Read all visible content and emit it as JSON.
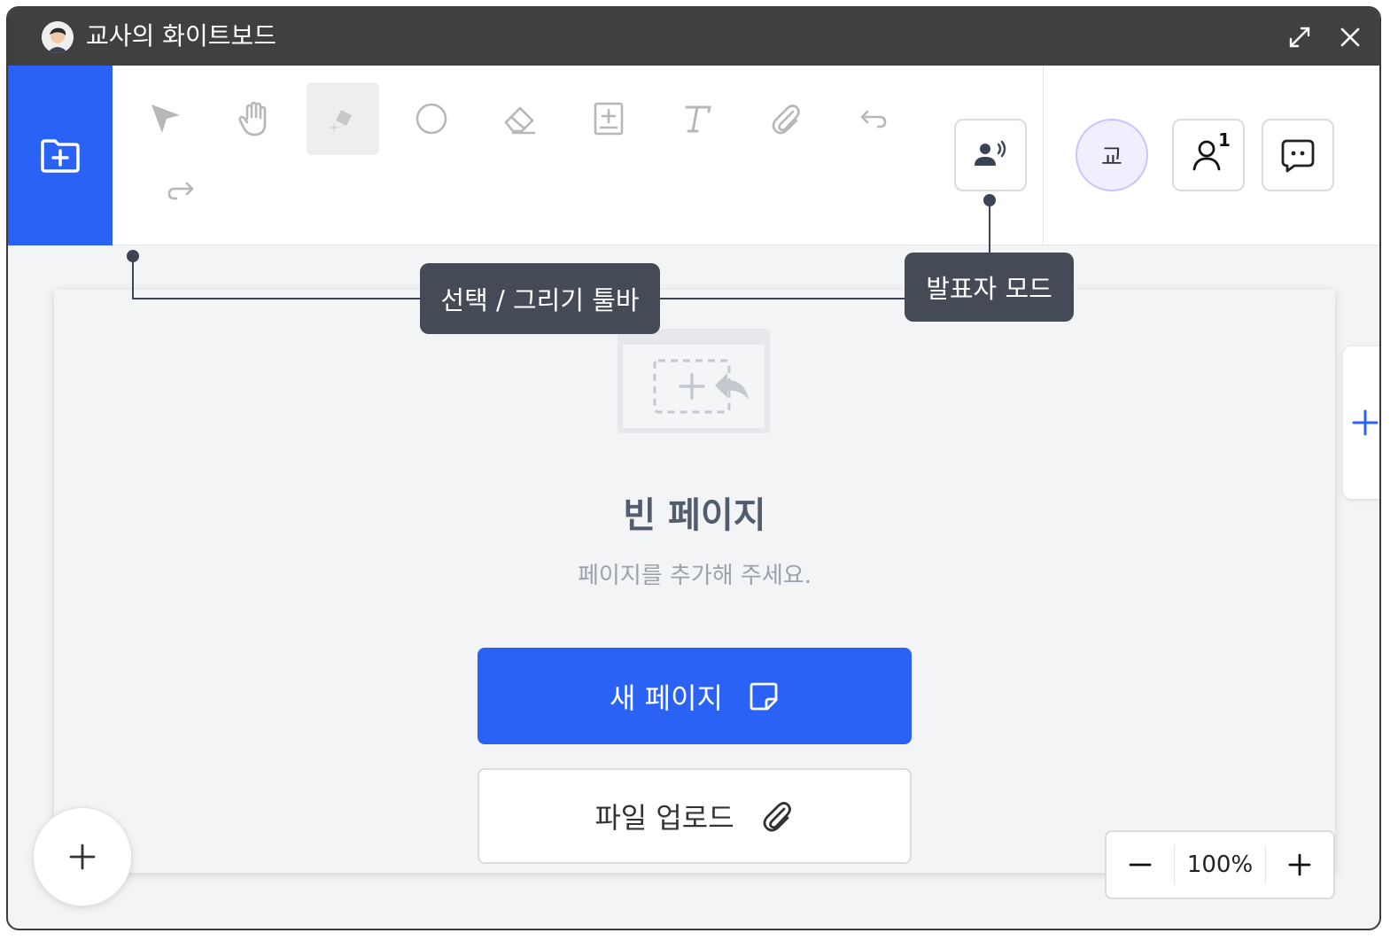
{
  "window": {
    "title": "교사의 화이트보드"
  },
  "toolbar": {
    "tools": [
      {
        "name": "select",
        "icon": "cursor-arrow-icon",
        "active": false
      },
      {
        "name": "pan",
        "icon": "hand-icon",
        "active": false
      },
      {
        "name": "pen",
        "icon": "highlighter-icon",
        "active": true
      },
      {
        "name": "shape",
        "icon": "circle-icon",
        "active": false
      },
      {
        "name": "eraser",
        "icon": "eraser-icon",
        "active": false
      },
      {
        "name": "add-frame",
        "icon": "add-frame-icon",
        "active": false
      },
      {
        "name": "text",
        "icon": "text-t-icon",
        "active": false
      },
      {
        "name": "attach",
        "icon": "paperclip-icon",
        "active": false
      },
      {
        "name": "undo",
        "icon": "undo-icon",
        "active": false
      },
      {
        "name": "redo",
        "icon": "redo-icon",
        "active": false
      }
    ],
    "presenter_icon": "presenter-speaker-icon"
  },
  "users": {
    "initial": "교",
    "participant_count": "1"
  },
  "empty_state": {
    "title": "빈 페이지",
    "subtitle": "페이지를 추가해 주세요.",
    "new_page_label": "새 페이지",
    "upload_label": "파일 업로드"
  },
  "zoom": {
    "value": "100%"
  },
  "callouts": {
    "toolbar_label": "선택 / 그리기 툴바",
    "presenter_label": "발표자 모드"
  },
  "colors": {
    "accent": "#2b62f6",
    "titlebar": "#404040",
    "tooltip": "#444b56"
  }
}
